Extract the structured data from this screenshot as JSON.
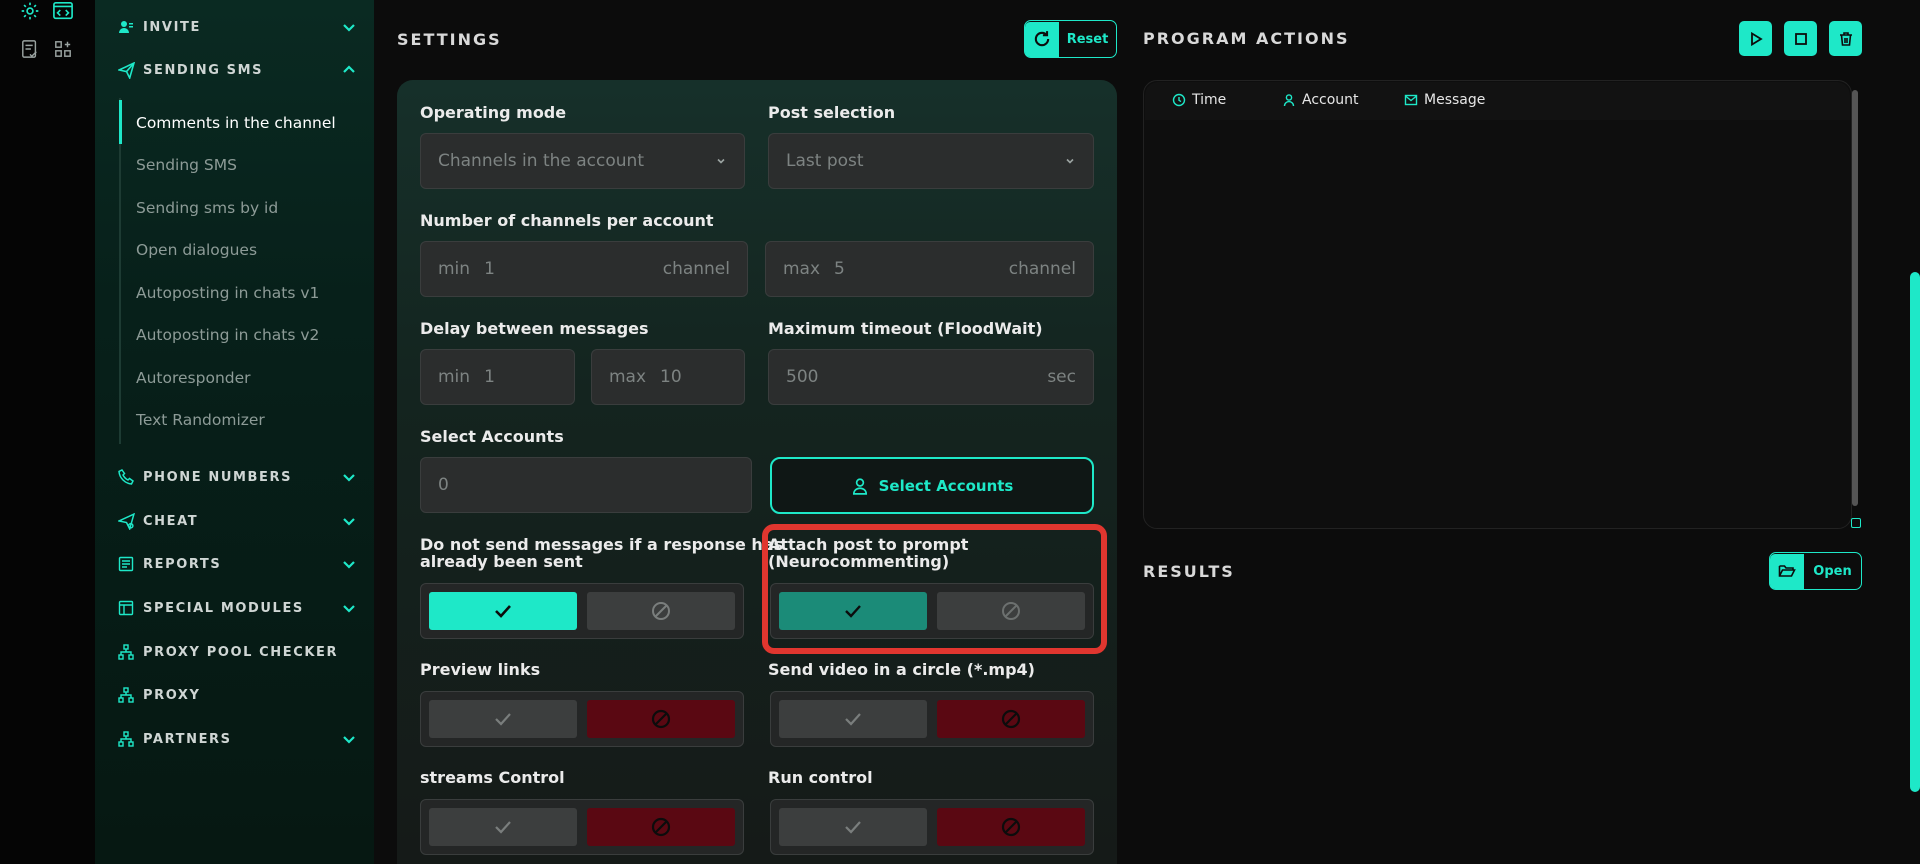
{
  "colors": {
    "accent": "#1ee8c8",
    "danger": "#5a0812",
    "highlight": "#e0362f"
  },
  "rail": {
    "icons": [
      "settings-icon",
      "code-icon",
      "checklist-icon",
      "apps-icon"
    ]
  },
  "sidebar": {
    "sections": [
      {
        "label": "INVITE",
        "icon": "user-plus-icon",
        "chevron": "down"
      },
      {
        "label": "SENDING SMS",
        "icon": "send-icon",
        "chevron": "up"
      },
      {
        "label": "PHONE NUMBERS",
        "icon": "phone-icon",
        "chevron": "down"
      },
      {
        "label": "CHEAT",
        "icon": "send-gear-icon",
        "chevron": "down"
      },
      {
        "label": "REPORTS",
        "icon": "report-icon",
        "chevron": "down"
      },
      {
        "label": "SPECIAL MODULES",
        "icon": "modules-icon",
        "chevron": "down"
      },
      {
        "label": "PROXY POOL CHECKER",
        "icon": "network-icon",
        "chevron": ""
      },
      {
        "label": "PROXY",
        "icon": "network-icon",
        "chevron": ""
      },
      {
        "label": "PARTNERS",
        "icon": "network-icon",
        "chevron": "down"
      }
    ],
    "sub_items": [
      {
        "label": "Comments in the channel",
        "active": true
      },
      {
        "label": "Sending SMS"
      },
      {
        "label": "Sending sms by id"
      },
      {
        "label": "Open dialogues"
      },
      {
        "label": "Autoposting in chats v1"
      },
      {
        "label": "Autoposting in chats v2"
      },
      {
        "label": "Autoresponder"
      },
      {
        "label": "Text Randomizer"
      }
    ]
  },
  "settings": {
    "title": "SETTINGS",
    "reset_label": "Reset",
    "operating_mode": {
      "label": "Operating mode",
      "value": "Channels in the account"
    },
    "post_selection": {
      "label": "Post selection",
      "value": "Last post"
    },
    "channels_per_account": {
      "label": "Number of channels per account",
      "min": {
        "prefix": "min",
        "value": "1",
        "suffix": "channel"
      },
      "max": {
        "prefix": "max",
        "value": "5",
        "suffix": "channel"
      }
    },
    "delay": {
      "label": "Delay between messages",
      "min": {
        "prefix": "min",
        "value": "1"
      },
      "max": {
        "prefix": "max",
        "value": "10"
      }
    },
    "timeout": {
      "label": "Maximum timeout (FloodWait)",
      "value": "500",
      "suffix": "sec"
    },
    "accounts": {
      "label": "Select Accounts",
      "value": "0",
      "button_label": "Select Accounts"
    },
    "toggles": [
      {
        "label_lines": [
          "Do not send messages if a response has",
          "already been sent"
        ],
        "state": "on"
      },
      {
        "label_lines": [
          "Attach post to prompt",
          "(Neurocommenting)"
        ],
        "state": "on"
      },
      {
        "label_lines": [
          "Preview links"
        ],
        "state": "off"
      },
      {
        "label_lines": [
          "Send video in a circle (*.mp4)"
        ],
        "state": "off"
      },
      {
        "label_lines": [
          "streams Control"
        ],
        "state": "off"
      },
      {
        "label_lines": [
          "Run control"
        ],
        "state": "off"
      }
    ]
  },
  "program_actions": {
    "title": "PROGRAM ACTIONS",
    "buttons": [
      "play-icon",
      "stop-icon",
      "trash-icon"
    ],
    "columns": [
      {
        "label": "Time",
        "icon": "clock-icon"
      },
      {
        "label": "Account",
        "icon": "user-icon"
      },
      {
        "label": "Message",
        "icon": "mail-icon"
      }
    ]
  },
  "results": {
    "title": "RESULTS",
    "open_label": "Open"
  }
}
